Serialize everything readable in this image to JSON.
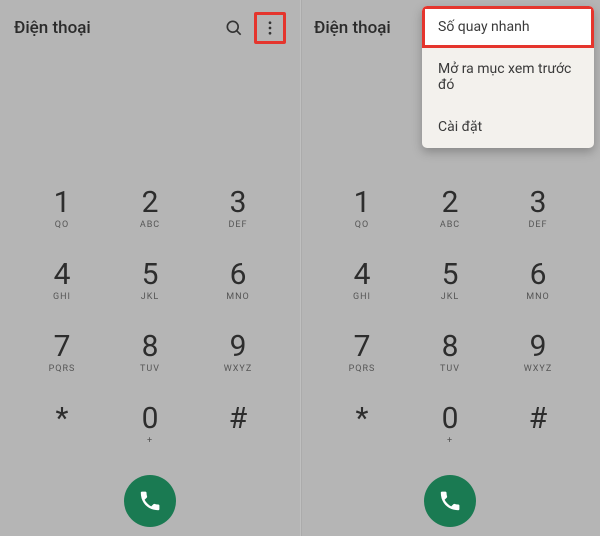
{
  "panel1": {
    "title": "Điện thoại"
  },
  "panel2": {
    "title": "Điện thoại"
  },
  "menu": {
    "items": [
      {
        "label": "Số quay nhanh"
      },
      {
        "label": "Mở ra mục xem trước đó"
      },
      {
        "label": "Cài đặt"
      }
    ]
  },
  "dialpad": {
    "keys": [
      {
        "digit": "1",
        "sub": "QO"
      },
      {
        "digit": "2",
        "sub": "ABC"
      },
      {
        "digit": "3",
        "sub": "DEF"
      },
      {
        "digit": "4",
        "sub": "GHI"
      },
      {
        "digit": "5",
        "sub": "JKL"
      },
      {
        "digit": "6",
        "sub": "MNO"
      },
      {
        "digit": "7",
        "sub": "PQRS"
      },
      {
        "digit": "8",
        "sub": "TUV"
      },
      {
        "digit": "9",
        "sub": "WXYZ"
      },
      {
        "digit": "*",
        "sub": ""
      },
      {
        "digit": "0",
        "sub": "+"
      },
      {
        "digit": "#",
        "sub": ""
      }
    ]
  },
  "colors": {
    "call_button": "#1a7a52",
    "highlight_border": "#e5352d"
  }
}
